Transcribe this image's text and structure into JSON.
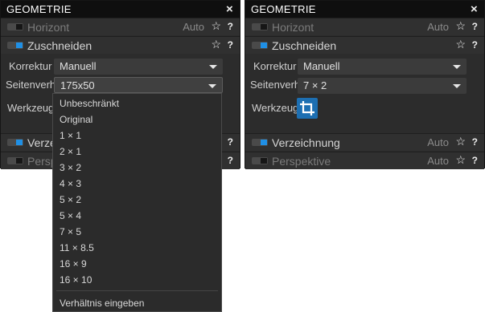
{
  "panel_title": "GEOMETRIE",
  "close_glyph": "×",
  "colors": {
    "accent": "#1f90e6",
    "tool_button": "#1d6fb2"
  },
  "left": {
    "rows": {
      "horizont": {
        "title": "Horizont",
        "auto": "Auto",
        "enabled": false
      },
      "zuschneiden": {
        "title": "Zuschneiden",
        "enabled": true
      },
      "verzeichnung": {
        "title": "Verze",
        "enabled": true
      },
      "perspektive": {
        "title": "Persp",
        "enabled": false
      }
    },
    "korrektur": {
      "label": "Korrektur",
      "value": "Manuell"
    },
    "seitenverh": {
      "label": "Seitenverh",
      "value": "175x50"
    },
    "werkzeug": {
      "label": "Werkzeug"
    },
    "dropdown": {
      "options": [
        "Unbeschränkt",
        "Original",
        "1 × 1",
        "2 × 1",
        "3 × 2",
        "4 × 3",
        "5 × 2",
        "5 × 4",
        "7 × 5",
        "11 × 8.5",
        "16 × 9",
        "16 × 10"
      ],
      "footer": "Verhältnis eingeben"
    }
  },
  "right": {
    "rows": {
      "horizont": {
        "title": "Horizont",
        "auto": "Auto",
        "enabled": false
      },
      "zuschneiden": {
        "title": "Zuschneiden",
        "enabled": true
      },
      "verzeichnung": {
        "title": "Verzeichnung",
        "auto": "Auto",
        "enabled": true
      },
      "perspektive": {
        "title": "Perspektive",
        "auto": "Auto",
        "enabled": false
      }
    },
    "korrektur": {
      "label": "Korrektur",
      "value": "Manuell"
    },
    "seitenverh": {
      "label": "Seitenverh",
      "value": "7 × 2"
    },
    "werkzeug": {
      "label": "Werkzeug",
      "tool_icon": "crop-icon"
    }
  },
  "icons": {
    "star": "☆",
    "help": "?"
  }
}
